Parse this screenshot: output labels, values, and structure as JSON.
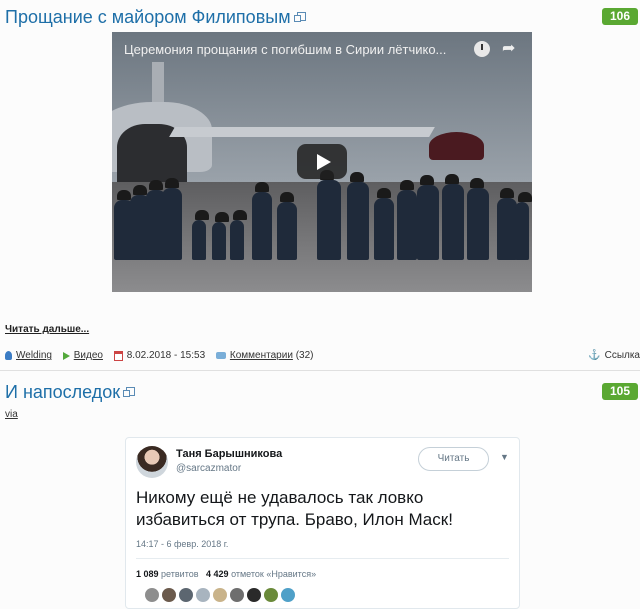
{
  "post1": {
    "title": "Прощание с майором Филиповым",
    "rating": "106",
    "video": {
      "title": "Церемония прощания с погибшим в Сирии лётчико..."
    },
    "read_more": "Читать дальше...",
    "meta": {
      "author": "Welding",
      "category": "Видео",
      "date": "8.02.2018 - 15:53",
      "comments_label": "Комментарии",
      "comments_count": "(32)",
      "link_label": "Ссылка"
    }
  },
  "post2": {
    "title": "И напоследок",
    "rating": "105",
    "via": "via",
    "tweet": {
      "name": "Таня Барышникова",
      "handle": "@sarcazmator",
      "follow_label": "Читать",
      "text": "Никому ещё не удавалось так ловко избавиться от трупа. Браво, Илон Маск!",
      "date": "14:17 - 6 февр. 2018 г.",
      "retweets_count": "1 089",
      "retweets_label": "ретвитов",
      "likes_count": "4 429",
      "likes_label": "отметок «Нравится»"
    }
  },
  "colors": {
    "title_link": "#1e6fa8",
    "rating_bg": "#5aa832",
    "user_icon": "#3b7cc4",
    "arrow_icon": "#53a93b"
  }
}
